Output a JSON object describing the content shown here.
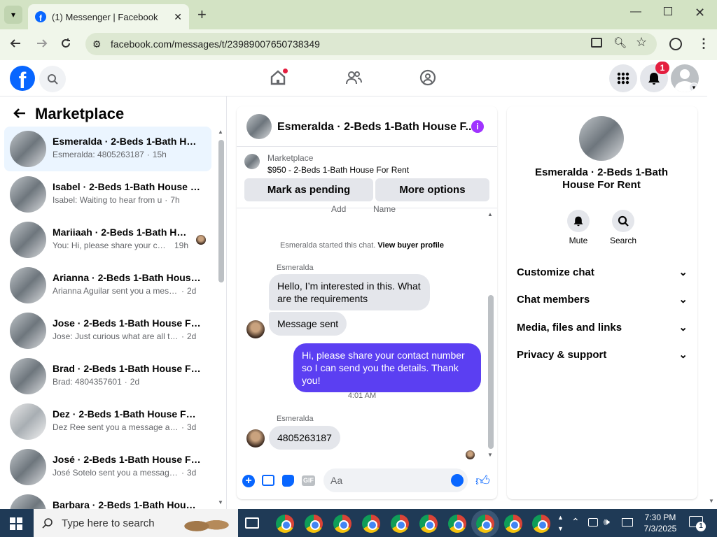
{
  "browser": {
    "tab_title": "(1) Messenger | Facebook",
    "url": "facebook.com/messages/t/23989007650738349"
  },
  "header": {
    "notification_count": "1"
  },
  "left_panel": {
    "title": "Marketplace",
    "conversations": [
      {
        "name": "Esmeralda · 2-Beds 1-Bath House For Rent",
        "preview": "Esmeralda: 4805263187",
        "time": "15h"
      },
      {
        "name": "Isabel · 2-Beds 1-Bath House For Rent",
        "preview": "Isabel: Waiting to hear from u",
        "time": "7h"
      },
      {
        "name": "Mariiaah · 2-Beds 1-Bath House For Rent",
        "preview": "You: Hi, please share your cont...",
        "time": "19h"
      },
      {
        "name": "Arianna · 2-Beds 1-Bath House For Rent",
        "preview": "Arianna Aguilar sent you a messag...",
        "time": "2d"
      },
      {
        "name": "Jose · 2-Beds 1-Bath House For Rent",
        "preview": "Jose: Just curious what are all the d...",
        "time": "2d"
      },
      {
        "name": "Brad · 2-Beds 1-Bath House For Rent",
        "preview": "Brad: 4804357601",
        "time": "2d"
      },
      {
        "name": "Dez · 2-Beds 1-Bath House For Rent",
        "preview": "Dez Ree sent you a message about...",
        "time": "3d"
      },
      {
        "name": "José · 2-Beds 1-Bath House For Rent",
        "preview": "José Sotelo sent you a message ab...",
        "time": "3d"
      },
      {
        "name": "Barbara · 2-Beds 1-Bath House For Rent",
        "preview": "",
        "time": ""
      }
    ]
  },
  "chat": {
    "header_title": "Esmeralda · 2-Beds 1-Bath House F...",
    "listing_label": "Marketplace",
    "listing_title": "$950 - 2-Beds 1-Bath House For Rent",
    "mark_pending": "Mark as pending",
    "more_options": "More options",
    "cut_add": "Add",
    "cut_name": "Name",
    "started_text": "Esmeralda started this chat.",
    "view_profile": "View buyer profile",
    "sender1": "Esmeralda",
    "msg1": "Hello, I’m interested in this. What are the requirements",
    "msg2": "Message sent",
    "msg3": "Hi, please share your contact number so I can send you the details. Thank you!",
    "timestamp": "4:01 AM",
    "sender2": "Esmeralda",
    "msg4": "4805263187",
    "input_placeholder": "Aa",
    "gif_label": "GIF"
  },
  "right_panel": {
    "name": "Esmeralda · 2-Beds 1-Bath House For Rent",
    "mute": "Mute",
    "search": "Search",
    "sections": [
      "Customize chat",
      "Chat members",
      "Media, files and links",
      "Privacy & support"
    ]
  },
  "taskbar": {
    "search_placeholder": "Type here to search",
    "time": "7:30 PM",
    "date": "7/3/2025",
    "notif": "1"
  },
  "colors": {
    "facebook_blue": "#0866ff",
    "messenger_purple": "#5b3ff2",
    "notification_red": "#e41e3f"
  }
}
